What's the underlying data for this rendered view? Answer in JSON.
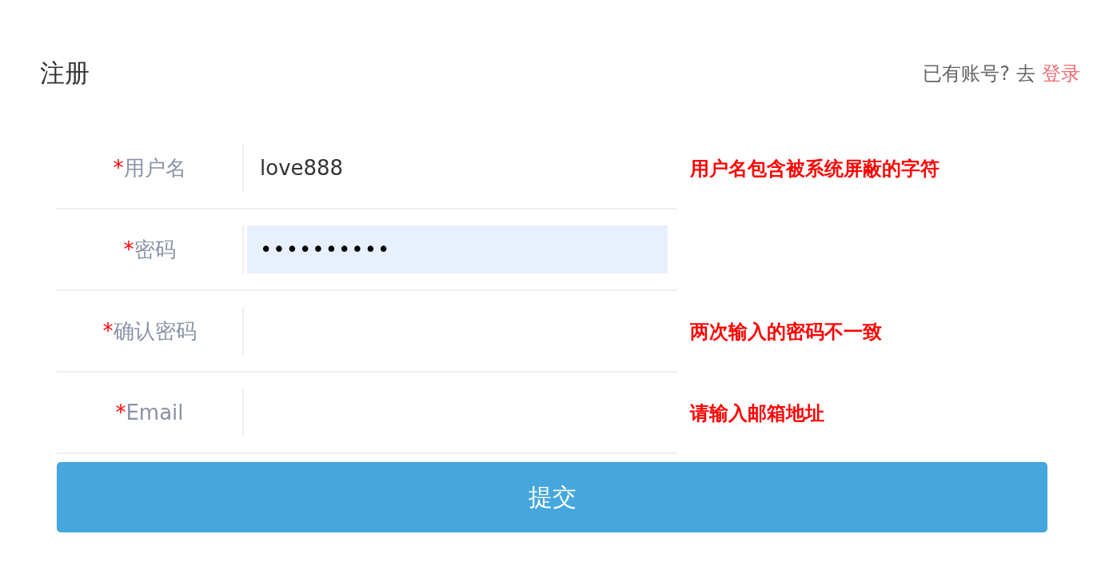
{
  "title": "注册",
  "login_prompt": {
    "text": "已有账号?",
    "go": "去",
    "link": "登录"
  },
  "fields": [
    {
      "mark": "*",
      "label": "用户名",
      "value": "love888",
      "highlighted": false,
      "error": "用户名包含被系统屏蔽的字符"
    },
    {
      "mark": "*",
      "label": "密码",
      "value": "••••••••••",
      "highlighted": true
    },
    {
      "mark": "*",
      "label": "确认密码",
      "highlighted": false,
      "error": "两次输入的密码不一致"
    },
    {
      "mark": "*",
      "label": "Email",
      "highlighted": false,
      "error": "请输入邮箱地址"
    }
  ],
  "submit": "提交"
}
